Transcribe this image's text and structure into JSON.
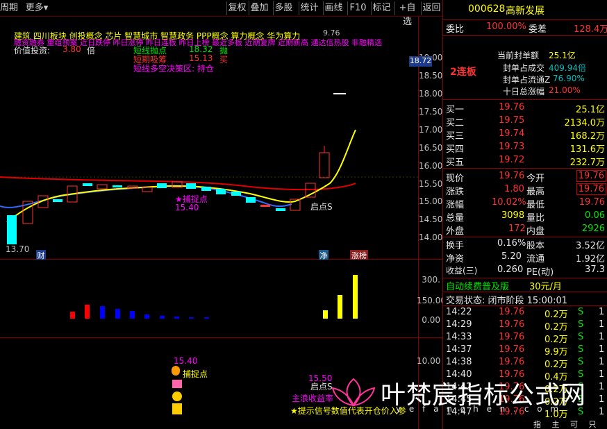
{
  "toolbar": {
    "period": "周期",
    "more": "更多",
    "buttons": [
      "复权",
      "叠加",
      "多股",
      "统计",
      "画线",
      "F10",
      "标记",
      "+自选",
      "返回"
    ]
  },
  "header": {
    "line1": "建筑  四川板块 创投概念 芯片 智慧城市 智慧政务 PPP概念 算力概念 华为算力",
    "line1_value": "9.76",
    "line2": "融资融券 重组预案 近日跌停 昨日涨停 昨日连板 昨日上榜 最近多板 近期复牌 近期新高 通达信热股 非融精选",
    "value_label": "价值投资:",
    "value_num": "3.80",
    "value_unit": "倍",
    "short_buy_label": "短线抛点",
    "short_buy_val": "18.32",
    "short_buy_act": "抛",
    "short_hold_label": "短期吸筹",
    "short_hold_val": "15.13",
    "short_hold_act": "买",
    "strategy_label": "短线多空决策区:",
    "strategy_val": "持仓"
  },
  "main_chart": {
    "price_ticks": [
      "19.00",
      "18.50",
      "18.00",
      "17.50",
      "17.00",
      "16.50",
      "16.00",
      "15.50",
      "15.00",
      "14.50",
      "14.00"
    ],
    "current_price_tag": "18.72",
    "low_label": "13.70",
    "catch_label": "★捕捉点",
    "catch_value": "15.40",
    "start_label": "启点S",
    "markers": {
      "cai": "财",
      "jing": "净",
      "zhangbang": "涨榜"
    }
  },
  "volume_chart": {
    "ticks": [
      "300.",
      "150.00",
      "0.00"
    ]
  },
  "signal_chart": {
    "tick": "10.00",
    "catch_value": "15.40",
    "catch_label": "捕捉点",
    "start_label": "启点S",
    "start_value": "15.50",
    "profit_label": "主浪收益率",
    "hint": "★提示信号数值代表开仓价入参"
  },
  "panel": {
    "code": "000628",
    "name": "高新发展",
    "weibi_label": "委比",
    "weibi": "100.00%",
    "weicha_label": "委差",
    "weicha": "128.4万",
    "lianban": "2连板",
    "seal_amount_label": "当前封单额",
    "seal_amount": "25.1亿",
    "seal_turnover_label": "封单占成交",
    "seal_turnover": "409.94倍",
    "seal_float_label": "封单占流通Z",
    "seal_float": "76.90%",
    "ten_day_label": "十日总涨幅",
    "ten_day": "21.00%",
    "bids": [
      {
        "label": "买一",
        "price": "19.76",
        "vol": "25.1亿"
      },
      {
        "label": "买二",
        "price": "19.75",
        "vol": "2134.0万"
      },
      {
        "label": "买三",
        "price": "19.74",
        "vol": "168.2万"
      },
      {
        "label": "买四",
        "price": "19.73",
        "vol": "131.6万"
      },
      {
        "label": "买五",
        "price": "19.72",
        "vol": "232.7万"
      }
    ],
    "quote": [
      {
        "l1": "现价",
        "v1": "19.76",
        "l2": "今开",
        "v2": "19.76"
      },
      {
        "l1": "涨跌",
        "v1": "1.80",
        "l2": "最高",
        "v2": "19.76"
      },
      {
        "l1": "涨幅",
        "v1": "10.02%",
        "l2": "最低",
        "v2": "19.76"
      },
      {
        "l1": "总量",
        "v1": "3098",
        "l2": "量比",
        "v2": "0.06"
      },
      {
        "l1": "外盘",
        "v1": "172",
        "l2": "内盘",
        "v2": "2926"
      }
    ],
    "fund": [
      {
        "l1": "换手",
        "v1": "0.16%",
        "l2": "股本",
        "v2": "3.52亿"
      },
      {
        "l1": "净资",
        "v1": "5.20",
        "l2": "流通",
        "v2": "1.92亿"
      },
      {
        "l1": "收益(三)",
        "v1": "0.260",
        "l2": "PE(动)",
        "v2": "37.3"
      }
    ],
    "promo": "自动续费普及版",
    "promo_price": "30元/月",
    "status": "交易状态: 闭市阶段 15:00:01",
    "trades": [
      {
        "time": "14:22",
        "price": "19.76",
        "vol": "0.2万",
        "side": "S",
        "n": "1"
      },
      {
        "time": "14:29",
        "price": "19.76",
        "vol": "0.2万",
        "side": "S",
        "n": "1"
      },
      {
        "time": "14:33",
        "price": "19.76",
        "vol": "0.2万",
        "side": "S",
        "n": "1"
      },
      {
        "time": "14:37",
        "price": "19.76",
        "vol": "9.9万",
        "side": "S",
        "n": "1"
      },
      {
        "time": "14:38",
        "price": "19.76",
        "vol": "0.2万",
        "side": "S",
        "n": "1"
      },
      {
        "time": "14:40",
        "price": "19.76",
        "vol": "0.4万",
        "side": "S",
        "n": "1"
      },
      {
        "time": "14:42",
        "price": "19.76",
        "vol": "0.2万",
        "side": "S",
        "n": "1"
      },
      {
        "time": "14:45",
        "price": "19.76",
        "vol": "0.2万",
        "side": "S",
        "n": "1"
      },
      {
        "time": "14:47",
        "price": "19.76",
        "vol": "1.0万",
        "side": "S",
        "n": "1"
      }
    ],
    "bottom_tabs": "指 主 可 只"
  },
  "watermark": {
    "title": "叶梵宸指标公式网",
    "sub": "y e f a n c h e n . c o m"
  }
}
